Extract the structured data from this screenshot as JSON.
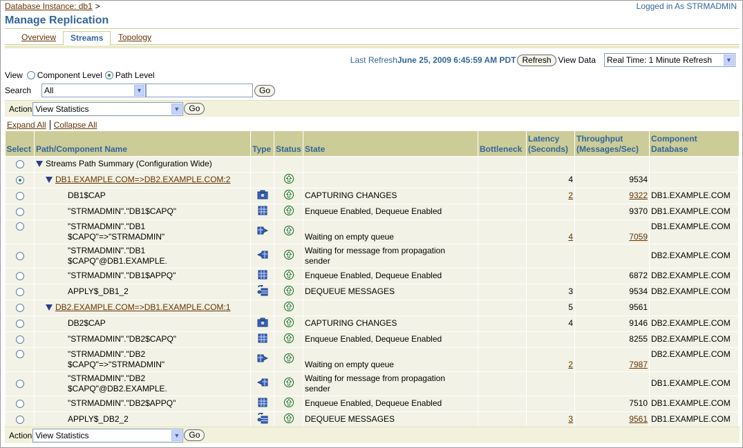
{
  "header": {
    "breadcrumb": "Database Instance: db1",
    "breadcrumb_sep": ">",
    "logged_in": "Logged in As STRMADMIN",
    "title": "Manage Replication"
  },
  "tabs": [
    {
      "label": "Overview",
      "active": false
    },
    {
      "label": "Streams",
      "active": true
    },
    {
      "label": "Topology",
      "active": false
    }
  ],
  "refresh": {
    "last_refresh_label": "Last Refresh",
    "last_refresh_date": "June 25, 2009 6:45:59 AM PDT",
    "refresh_button": "Refresh",
    "view_data_label": "View Data",
    "view_data_value": "Real Time: 1 Minute Refresh"
  },
  "view": {
    "label": "View",
    "option1": "Component Level",
    "option2": "Path Level",
    "selected": "Path Level"
  },
  "search": {
    "label": "Search",
    "select_value": "All",
    "text_value": "",
    "go": "Go"
  },
  "action": {
    "label": "Action",
    "select_value": "View Statistics",
    "go": "Go"
  },
  "expand_all": "Expand All",
  "collapse_all": "Collapse All",
  "columns": {
    "select": "Select",
    "name": "Path/Component Name",
    "type": "Type",
    "status": "Status",
    "state": "State",
    "bottleneck": "Bottleneck",
    "latency_1": "Latency",
    "latency_2": "(Seconds)",
    "throughput_1": "Throughput",
    "throughput_2": "(Messages/Sec)",
    "compdb_1": "Component",
    "compdb_2": "Database"
  },
  "rows": {
    "summary": {
      "name": "Streams Path Summary (Configuration Wide)"
    },
    "p1": {
      "name": "DB1.EXAMPLE.COM=>DB2.EXAMPLE.COM:2",
      "latency": "4",
      "throughput": "9534"
    },
    "r1": {
      "name": "DB1$CAP",
      "type_icon": "capture-icon",
      "state": "CAPTURING CHANGES",
      "latency": "2",
      "throughput": "9322",
      "db": "DB1.EXAMPLE.COM"
    },
    "r2": {
      "name": "\"STRMADMIN\".\"DB1$CAPQ\"",
      "type_icon": "queue-icon",
      "state": "Enqueue Enabled, Dequeue Enabled",
      "throughput": "9370",
      "db": "DB1.EXAMPLE.COM"
    },
    "r3": {
      "name_1": "\"STRMADMIN\".\"DB1",
      "name_2": "$CAPQ\"=>\"STRMADMIN\"",
      "type_icon": "propagation-sender-icon",
      "state": "Waiting on empty queue",
      "latency": "4",
      "throughput": "7059",
      "db": "DB1.EXAMPLE.COM"
    },
    "r4": {
      "name_1": "\"STRMADMIN\".\"DB1",
      "name_2": "$CAPQ\"@DB1.EXAMPLE.",
      "type_icon": "propagation-receiver-icon",
      "state_1": "Waiting for message from propagation",
      "state_2": "sender",
      "db": "DB2.EXAMPLE.COM"
    },
    "r5": {
      "name": "\"STRMADMIN\".\"DB1$APPQ\"",
      "type_icon": "queue-icon",
      "state": "Enqueue Enabled, Dequeue Enabled",
      "throughput": "6872",
      "db": "DB2.EXAMPLE.COM"
    },
    "r6": {
      "name": "APPLY$_DB1_2",
      "type_icon": "apply-icon",
      "state": "DEQUEUE MESSAGES",
      "latency": "3",
      "throughput": "9534",
      "db": "DB2.EXAMPLE.COM"
    },
    "p2": {
      "name": "DB2.EXAMPLE.COM=>DB1.EXAMPLE.COM:1",
      "latency": "5",
      "throughput": "9561"
    },
    "s1": {
      "name": "DB2$CAP",
      "type_icon": "capture-icon",
      "state": "CAPTURING CHANGES",
      "latency": "4",
      "throughput": "9146",
      "db": "DB2.EXAMPLE.COM"
    },
    "s2": {
      "name": "\"STRMADMIN\".\"DB2$CAPQ\"",
      "type_icon": "queue-icon",
      "state": "Enqueue Enabled, Dequeue Enabled",
      "throughput": "8255",
      "db": "DB2.EXAMPLE.COM"
    },
    "s3": {
      "name_1": "\"STRMADMIN\".\"DB2",
      "name_2": "$CAPQ\"=>\"STRMADMIN\"",
      "type_icon": "propagation-sender-icon",
      "state": "Waiting on empty queue",
      "latency": "2",
      "throughput": "7987",
      "db": "DB2.EXAMPLE.COM"
    },
    "s4": {
      "name_1": "\"STRMADMIN\".\"DB2",
      "name_2": "$CAPQ\"@DB2.EXAMPLE.",
      "type_icon": "propagation-receiver-icon",
      "state_1": "Waiting for message from propagation",
      "state_2": "sender",
      "db": "DB1.EXAMPLE.COM"
    },
    "s5": {
      "name": "\"STRMADMIN\".\"DB2$APPQ\"",
      "type_icon": "queue-icon",
      "state": "Enqueue Enabled, Dequeue Enabled",
      "throughput": "7510",
      "db": "DB1.EXAMPLE.COM"
    },
    "s6": {
      "name": "APPLY$_DB2_2",
      "type_icon": "apply-icon",
      "state": "DEQUEUE MESSAGES",
      "latency": "3",
      "throughput": "9561",
      "db": "DB1.EXAMPLE.COM"
    }
  },
  "colors": {
    "header_blue": "#336699",
    "table_header_bg": "#cccc99",
    "row_bg": "#f2f2e6",
    "link_brown": "#663300"
  }
}
